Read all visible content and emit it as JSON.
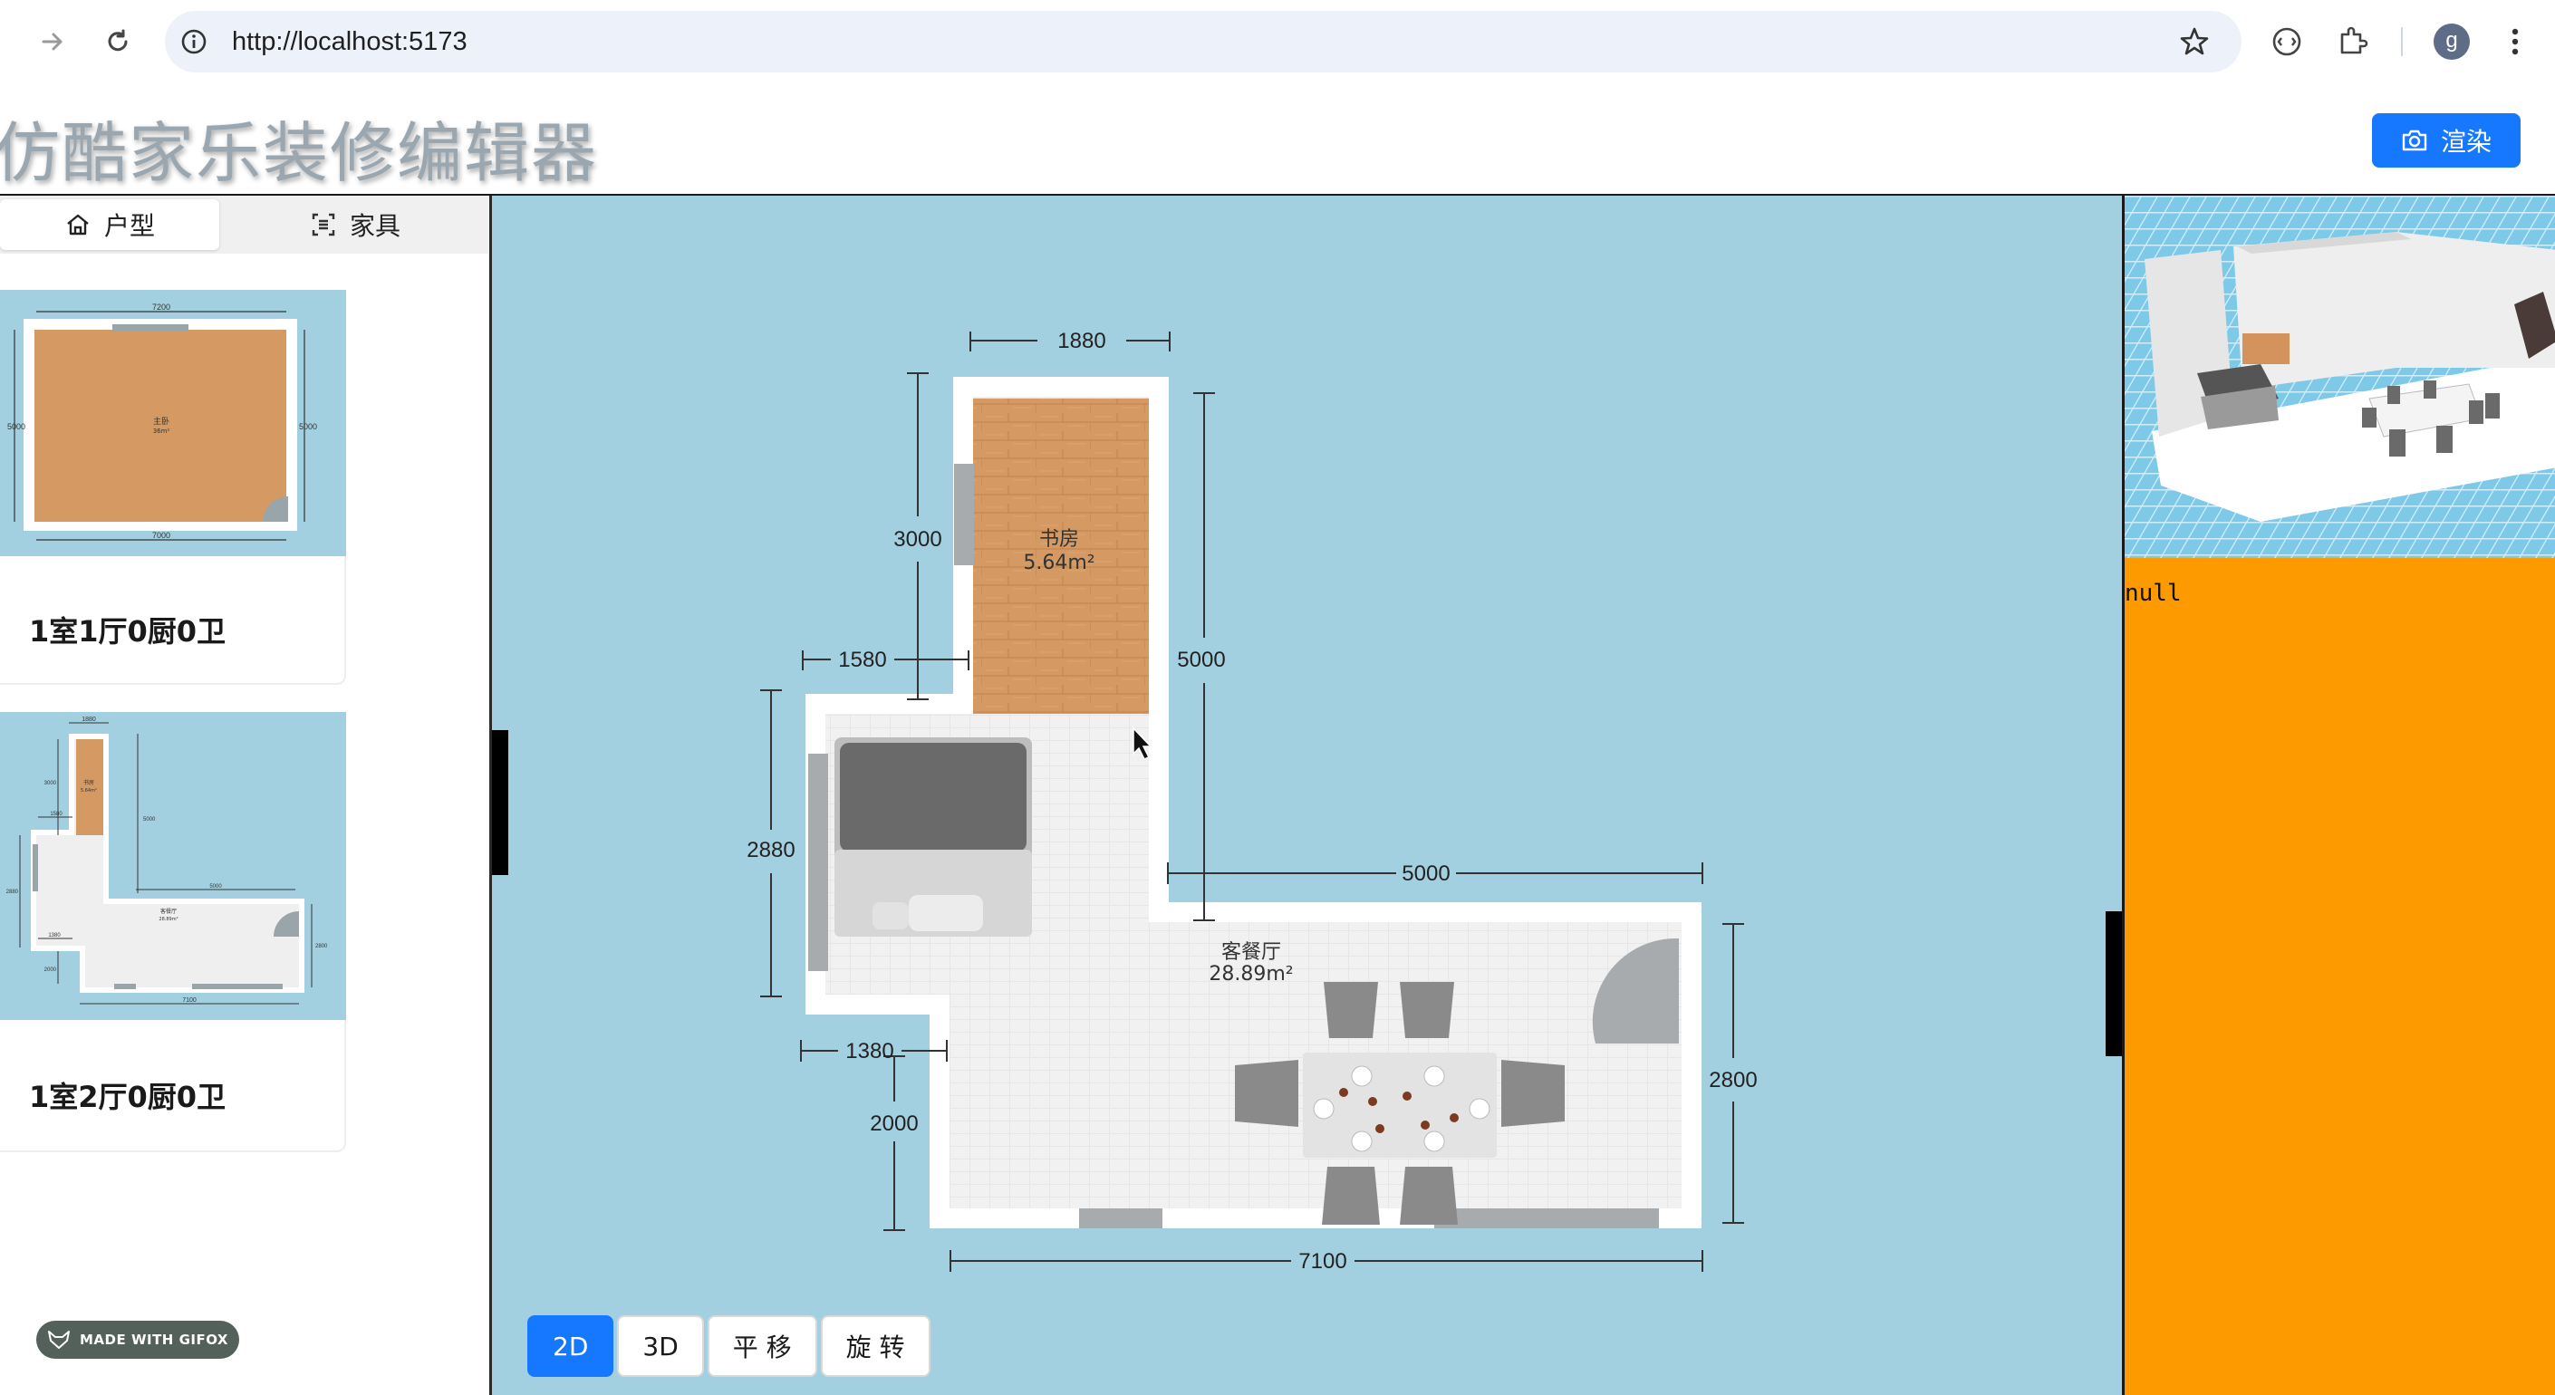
{
  "browser": {
    "url": "http://localhost:5173",
    "profile_initial": "g",
    "icons": [
      "forward-icon",
      "reload-icon",
      "site-info-icon",
      "bookmark-star-icon",
      "extension-puzzle-icon",
      "media-icon",
      "more-menu-icon"
    ]
  },
  "app": {
    "title": "仿酷家乐装修编辑器",
    "render_button": "渲染"
  },
  "sidebar": {
    "tabs": [
      {
        "label": "户型",
        "icon": "home-icon",
        "selected": true
      },
      {
        "label": "家具",
        "icon": "furniture-scan-icon",
        "selected": false
      }
    ],
    "cards": [
      {
        "title": "1室1厅0厨0卫",
        "thumb_labels": {
          "top": "7200",
          "left": "5000",
          "right": "5000",
          "bottom": "7000",
          "room": "主卧",
          "area": "36m²"
        }
      },
      {
        "title": "1室2厅0厨0卫",
        "thumb_labels": {
          "top": "1880",
          "room1": "书房",
          "area1": "5.64m²",
          "d1": "3000",
          "d2": "5000",
          "d3": "1580",
          "d4": "2880",
          "d5": "5000",
          "room2": "客餐厅",
          "area2": "28.89m²",
          "d6": "1380",
          "d7": "2000",
          "d8": "2800",
          "bottom": "7100"
        }
      }
    ],
    "watermark": "MADE WITH GIFOX"
  },
  "floorplan": {
    "dimensions": {
      "study_width": "1880",
      "study_height": "3000",
      "left_offset": "1580",
      "right_height": "5000",
      "left_height": "2880",
      "living_right_width": "5000",
      "step_width": "1380",
      "lower_left_height": "2000",
      "right_wall_height": "2800",
      "total_width": "7100"
    },
    "rooms": [
      {
        "name": "书房",
        "area": "5.64m²"
      },
      {
        "name": "客餐厅",
        "area": "28.89m²"
      }
    ]
  },
  "modes": [
    {
      "label": "2D",
      "active": true
    },
    {
      "label": "3D",
      "active": false
    },
    {
      "label": "平 移",
      "active": false
    },
    {
      "label": "旋 转",
      "active": false
    }
  ],
  "right_panel": {
    "output": "null"
  },
  "colors": {
    "accent": "#1677ff",
    "canvas_bg": "#a3d0e0",
    "right_panel_bg": "#fd9a00",
    "wood": "#d59a63"
  }
}
